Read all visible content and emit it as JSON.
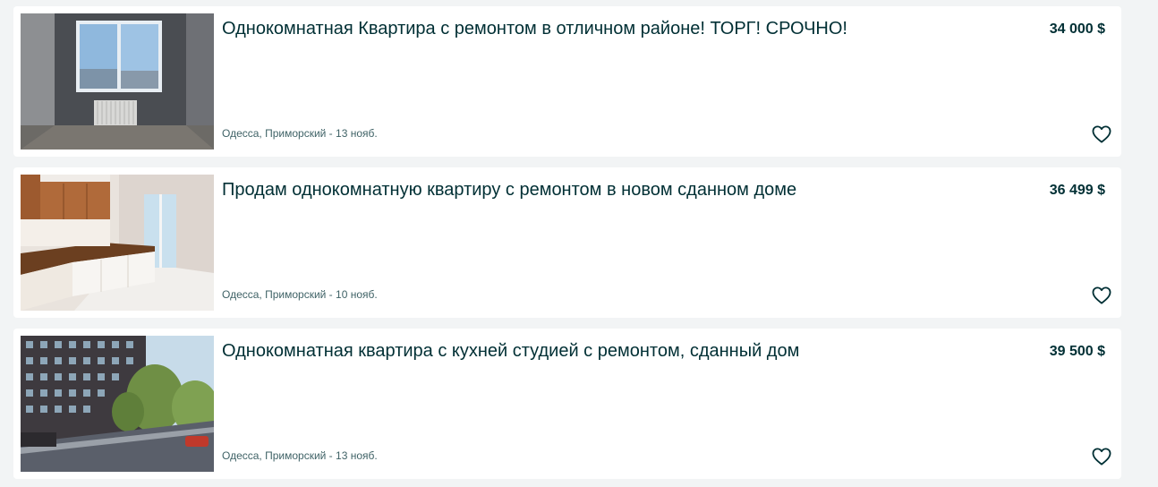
{
  "listings": [
    {
      "title": "Однокомнатная Квартира с ремонтом в отличном районе! ТОРГ! СРОЧНО!",
      "price": "34 000 $",
      "location": "Одесса, Приморский",
      "date": "13 нояб."
    },
    {
      "title": "Продам однокомнатную квартиру с ремонтом в новом сданном доме",
      "price": "36 499 $",
      "location": "Одесса, Приморский",
      "date": "10 нояб."
    },
    {
      "title": "Однокомнатная квартира с кухней студией с ремонтом, сданный дом",
      "price": "39 500 $",
      "location": "Одесса, Приморский",
      "date": "13 нояб."
    }
  ],
  "meta_separator": " - ",
  "colors": {
    "text": "#002f34",
    "meta": "#406367",
    "card_bg": "#ffffff",
    "page_bg": "#f2f4f5"
  },
  "icons": {
    "favorite": "heart-outline-icon"
  }
}
